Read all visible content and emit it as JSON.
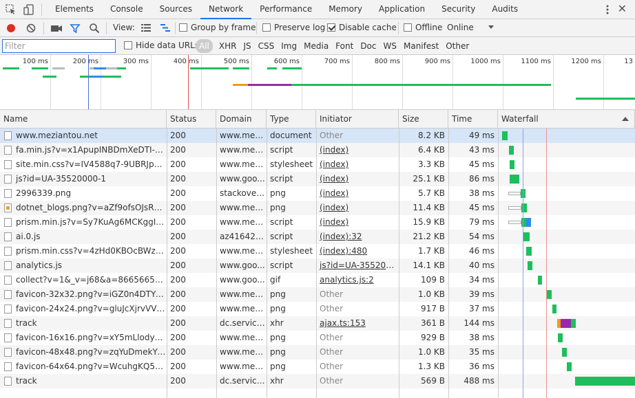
{
  "tabs": [
    "Elements",
    "Console",
    "Sources",
    "Network",
    "Performance",
    "Memory",
    "Application",
    "Security",
    "Audits"
  ],
  "active_tab": 3,
  "toolbar": {
    "view_label": "View:",
    "group_by_frame": "Group by frame",
    "preserve_log": "Preserve log",
    "disable_cache": "Disable cache",
    "offline": "Offline",
    "throttle": "Online"
  },
  "filter": {
    "placeholder": "Filter",
    "hide_data_urls": "Hide data URLs",
    "types": [
      "All",
      "XHR",
      "JS",
      "CSS",
      "Img",
      "Media",
      "Font",
      "Doc",
      "WS",
      "Manifest",
      "Other"
    ]
  },
  "overview": {
    "ticks": [
      "100 ms",
      "200 ms",
      "300 ms",
      "400 ms",
      "500 ms",
      "600 ms",
      "700 ms",
      "800 ms",
      "900 ms",
      "1000 ms",
      "1100 ms",
      "1200 ms",
      "13"
    ]
  },
  "columns": [
    "Name",
    "Status",
    "Domain",
    "Type",
    "Initiator",
    "Size",
    "Time",
    "Waterfall"
  ],
  "rows": [
    {
      "name": "www.meziantou.net",
      "status": "200",
      "domain": "www.mezi...",
      "type": "document",
      "initiator": "Other",
      "size": "8.2 KB",
      "time": "49 ms"
    },
    {
      "name": "fa.min.js?v=x1ApupINBDmXeDTI-yRHK...",
      "status": "200",
      "domain": "www.mezi...",
      "type": "script",
      "initiator": "(index)",
      "size": "6.4 KB",
      "time": "43 ms"
    },
    {
      "name": "site.min.css?v=IV4588q7-9UBRJp6oRI-...",
      "status": "200",
      "domain": "www.mezi...",
      "type": "stylesheet",
      "initiator": "(index)",
      "size": "3.3 KB",
      "time": "45 ms"
    },
    {
      "name": "js?id=UA-35520000-1",
      "status": "200",
      "domain": "www.goo...",
      "type": "script",
      "initiator": "(index)",
      "size": "25.1 KB",
      "time": "86 ms"
    },
    {
      "name": "2996339.png",
      "status": "200",
      "domain": "stackoverf...",
      "type": "png",
      "initiator": "(index)",
      "size": "5.7 KB",
      "time": "38 ms"
    },
    {
      "name": "dotnet_blogs.png?v=aZf9ofsOJsR3cjyp...",
      "status": "200",
      "domain": "www.mezi...",
      "type": "png",
      "initiator": "(index)",
      "size": "11.4 KB",
      "time": "45 ms"
    },
    {
      "name": "prism.min.js?v=Sy7KuAg6MCKggIA_to...",
      "status": "200",
      "domain": "www.mezi...",
      "type": "script",
      "initiator": "(index)",
      "size": "15.9 KB",
      "time": "79 ms"
    },
    {
      "name": "ai.0.js",
      "status": "200",
      "domain": "az416426....",
      "type": "script",
      "initiator": "(index):32",
      "size": "21.2 KB",
      "time": "54 ms"
    },
    {
      "name": "prism.min.css?v=4zHd0KBOcBWzqQV...",
      "status": "200",
      "domain": "www.mezi...",
      "type": "stylesheet",
      "initiator": "(index):480",
      "size": "1.7 KB",
      "time": "46 ms"
    },
    {
      "name": "analytics.js",
      "status": "200",
      "domain": "www.goo...",
      "type": "script",
      "initiator": "js?id=UA-3552000...",
      "size": "14.1 KB",
      "time": "40 ms"
    },
    {
      "name": "collect?v=1&_v=j68&a=866566513&t...",
      "status": "200",
      "domain": "www.goo...",
      "type": "gif",
      "initiator": "analytics.js:2",
      "size": "109 B",
      "time": "34 ms"
    },
    {
      "name": "favicon-32x32.png?v=iGZ0n4DTYCcIW...",
      "status": "200",
      "domain": "www.mezi...",
      "type": "png",
      "initiator": "Other",
      "size": "1.0 KB",
      "time": "39 ms"
    },
    {
      "name": "favicon-24x24.png?v=gluJcXjrvVVHhQ...",
      "status": "200",
      "domain": "www.mezi...",
      "type": "png",
      "initiator": "Other",
      "size": "917 B",
      "time": "37 ms"
    },
    {
      "name": "track",
      "status": "200",
      "domain": "dc.service....",
      "type": "xhr",
      "initiator": "ajax.ts:153",
      "size": "361 B",
      "time": "144 ms"
    },
    {
      "name": "favicon-16x16.png?v=xY5mLlody2mQ...",
      "status": "200",
      "domain": "www.mezi...",
      "type": "png",
      "initiator": "Other",
      "size": "929 B",
      "time": "38 ms"
    },
    {
      "name": "favicon-48x48.png?v=zqYuDmekYiorJk...",
      "status": "200",
      "domain": "www.mezi...",
      "type": "png",
      "initiator": "Other",
      "size": "1.0 KB",
      "time": "35 ms"
    },
    {
      "name": "favicon-64x64.png?v=WcuhgKQ5cBbp...",
      "status": "200",
      "domain": "www.mezi...",
      "type": "png",
      "initiator": "Other",
      "size": "1.3 KB",
      "time": "36 ms"
    },
    {
      "name": "track",
      "status": "200",
      "domain": "dc.service....",
      "type": "xhr",
      "initiator": "Other",
      "size": "569 B",
      "time": "488 ms"
    }
  ],
  "colors": {
    "accent": "#1a73e8",
    "record": "#d93025",
    "waterfall_green": "#1dbf5c",
    "waterfall_blue": "#2b8df0",
    "waterfall_purple": "#9b27b0",
    "waterfall_orange": "#f29c11"
  }
}
